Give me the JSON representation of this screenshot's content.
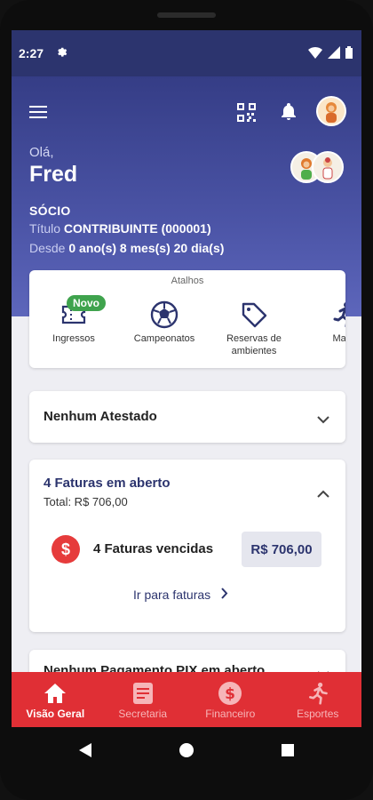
{
  "status_bar": {
    "time": "2:27"
  },
  "header": {
    "menu_icon": "hamburger-icon",
    "qr_icon": "qr-code-icon",
    "bell_icon": "bell-icon"
  },
  "user": {
    "greeting": "Olá,",
    "name": "Fred",
    "role": "SÓCIO",
    "title_label": "Título",
    "title_value": "CONTRIBUINTE (000001)",
    "since_label": "Desde",
    "since_value": "0 ano(s) 8 mes(s) 20 dia(s)"
  },
  "shortcuts": {
    "title": "Atalhos",
    "items": [
      {
        "label": "Ingressos",
        "icon": "ticket-icon",
        "badge": "Novo"
      },
      {
        "label": "Campeonatos",
        "icon": "soccer-ball-icon"
      },
      {
        "label": "Reservas de ambientes",
        "icon": "tag-icon"
      },
      {
        "label": "Matrí",
        "icon": "runner-icon"
      }
    ]
  },
  "atestado_card": {
    "title": "Nenhum Atestado"
  },
  "invoices_card": {
    "title": "4 Faturas em aberto",
    "total": "Total: R$ 706,00",
    "overdue_label": "4 Faturas vencidas",
    "overdue_amount": "R$ 706,00",
    "link": "Ir para faturas"
  },
  "pix_card": {
    "title": "Nenhum Pagamento PIX em aberto"
  },
  "bottom_nav": [
    {
      "label": "Visão Geral",
      "icon": "home-icon",
      "active": true
    },
    {
      "label": "Secretaria",
      "icon": "document-icon",
      "active": false
    },
    {
      "label": "Financeiro",
      "icon": "dollar-circle-icon",
      "active": false
    },
    {
      "label": "Esportes",
      "icon": "runner-icon",
      "active": false
    }
  ],
  "colors": {
    "primary": "#2c346e",
    "accent_red": "#e02f35",
    "badge_green": "#3fa34d"
  }
}
